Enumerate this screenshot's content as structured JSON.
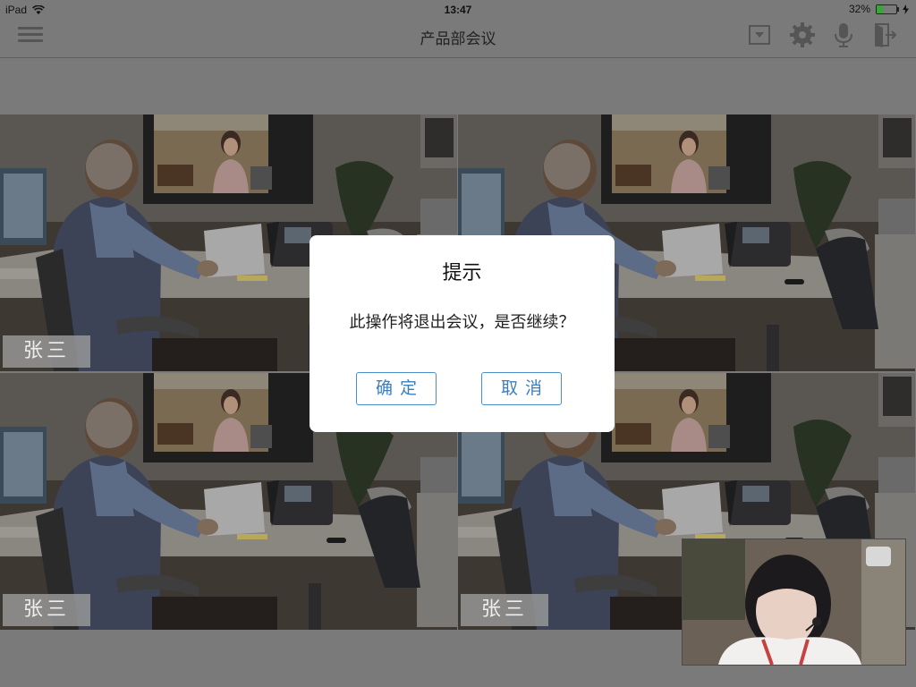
{
  "status_bar": {
    "device": "iPad",
    "time": "13:47",
    "battery_percent": "32%",
    "battery_level": 0.32
  },
  "nav": {
    "title": "产品部会议",
    "icons": [
      "menu-icon",
      "dropdown-icon",
      "gear-icon",
      "microphone-icon",
      "exit-icon"
    ]
  },
  "participants": [
    {
      "name": "张三"
    },
    {
      "name": ""
    },
    {
      "name": "张三"
    },
    {
      "name": "张三"
    }
  ],
  "dialog": {
    "title": "提示",
    "message": "此操作将退出会议，是否继续？",
    "confirm_label": "确定",
    "cancel_label": "取消"
  },
  "colors": {
    "overlay_dim": "#7a7a7a",
    "dialog_button": "#3b7fbf",
    "battery_fill": "#3aa63a"
  }
}
